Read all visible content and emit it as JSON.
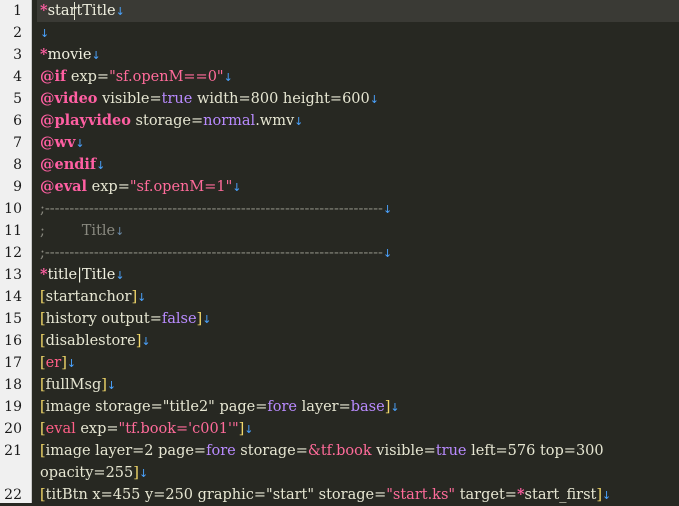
{
  "editor": {
    "eol_glyph": "↓",
    "lines": [
      {
        "n": "1",
        "current": true,
        "tokens": [
          [
            "star",
            "*"
          ],
          [
            "label",
            "startTitle"
          ],
          [
            "eol",
            ""
          ]
        ]
      },
      {
        "n": "2",
        "tokens": [
          [
            "eol",
            ""
          ]
        ]
      },
      {
        "n": "3",
        "tokens": [
          [
            "star",
            "*"
          ],
          [
            "label",
            "movie"
          ],
          [
            "eol",
            ""
          ]
        ]
      },
      {
        "n": "4",
        "tokens": [
          [
            "macro",
            "@if"
          ],
          [
            "plain",
            " "
          ],
          [
            "attr",
            "exp"
          ],
          [
            "plain",
            "="
          ],
          [
            "str",
            "\"sf.openM==0\""
          ],
          [
            "eol",
            ""
          ]
        ]
      },
      {
        "n": "5",
        "tokens": [
          [
            "macro",
            "@video"
          ],
          [
            "plain",
            " "
          ],
          [
            "attr",
            "visible"
          ],
          [
            "plain",
            "="
          ],
          [
            "kw",
            "true"
          ],
          [
            "plain",
            " "
          ],
          [
            "attr",
            "width"
          ],
          [
            "plain",
            "=800 "
          ],
          [
            "attr",
            "height"
          ],
          [
            "plain",
            "=600"
          ],
          [
            "eol",
            ""
          ]
        ]
      },
      {
        "n": "6",
        "tokens": [
          [
            "macro",
            "@playvideo"
          ],
          [
            "plain",
            " "
          ],
          [
            "attr",
            "storage"
          ],
          [
            "plain",
            "="
          ],
          [
            "kw",
            "normal"
          ],
          [
            "plain",
            ".wmv"
          ],
          [
            "eol",
            ""
          ]
        ]
      },
      {
        "n": "7",
        "tokens": [
          [
            "macro",
            "@wv"
          ],
          [
            "eol",
            ""
          ]
        ]
      },
      {
        "n": "8",
        "tokens": [
          [
            "macro",
            "@endif"
          ],
          [
            "eol",
            ""
          ]
        ]
      },
      {
        "n": "9",
        "tokens": [
          [
            "macro",
            "@eval"
          ],
          [
            "plain",
            " "
          ],
          [
            "attr",
            "exp"
          ],
          [
            "plain",
            "="
          ],
          [
            "str",
            "\"sf.openM=1\""
          ],
          [
            "eol",
            ""
          ]
        ]
      },
      {
        "n": "10",
        "tokens": [
          [
            "comment",
            ";---------------------------------------------------------------------"
          ],
          [
            "eol",
            ""
          ]
        ]
      },
      {
        "n": "11",
        "tokens": [
          [
            "comment",
            ";        Title"
          ],
          [
            "eoldim",
            ""
          ]
        ]
      },
      {
        "n": "12",
        "tokens": [
          [
            "comment",
            ";---------------------------------------------------------------------"
          ],
          [
            "eol",
            ""
          ]
        ]
      },
      {
        "n": "13",
        "tokens": [
          [
            "star",
            "*"
          ],
          [
            "label",
            "title|Title"
          ],
          [
            "eol",
            ""
          ]
        ]
      },
      {
        "n": "14",
        "tokens": [
          [
            "brk",
            "["
          ],
          [
            "plain",
            "startanchor"
          ],
          [
            "brk",
            "]"
          ],
          [
            "eol",
            ""
          ]
        ]
      },
      {
        "n": "15",
        "tokens": [
          [
            "brk",
            "["
          ],
          [
            "plain",
            "history output="
          ],
          [
            "kw",
            "false"
          ],
          [
            "brk",
            "]"
          ],
          [
            "eol",
            ""
          ]
        ]
      },
      {
        "n": "16",
        "tokens": [
          [
            "brk",
            "["
          ],
          [
            "plain",
            "disablestore"
          ],
          [
            "brk",
            "]"
          ],
          [
            "eol",
            ""
          ]
        ]
      },
      {
        "n": "17",
        "tokens": [
          [
            "brk",
            "["
          ],
          [
            "strv",
            "er"
          ],
          [
            "brk",
            "]"
          ],
          [
            "eol",
            ""
          ]
        ]
      },
      {
        "n": "18",
        "tokens": [
          [
            "brk",
            "["
          ],
          [
            "plain",
            "fullMsg"
          ],
          [
            "brk",
            "]"
          ],
          [
            "eol",
            ""
          ]
        ]
      },
      {
        "n": "19",
        "tokens": [
          [
            "brk",
            "["
          ],
          [
            "plain",
            "image storage=\"title2\" page="
          ],
          [
            "kw",
            "fore"
          ],
          [
            "plain",
            " layer="
          ],
          [
            "kw",
            "base"
          ],
          [
            "brk",
            "]"
          ],
          [
            "eol",
            ""
          ]
        ]
      },
      {
        "n": "20",
        "tokens": [
          [
            "brk",
            "["
          ],
          [
            "strv",
            "eval"
          ],
          [
            "plain",
            " exp="
          ],
          [
            "str",
            "\"tf.book='c001'\""
          ],
          [
            "brk",
            "]"
          ],
          [
            "eol",
            ""
          ]
        ]
      },
      {
        "n": "21",
        "tokens": [
          [
            "brk",
            "["
          ],
          [
            "plain",
            "image layer=2 page="
          ],
          [
            "kw",
            "fore"
          ],
          [
            "plain",
            " storage="
          ],
          [
            "str",
            "&tf.book"
          ],
          [
            "plain",
            " visible="
          ],
          [
            "kw",
            "true"
          ],
          [
            "plain",
            " left=576 top=300"
          ]
        ]
      },
      {
        "n": "",
        "tokens": [
          [
            "plain",
            "opacity=255"
          ],
          [
            "brk",
            "]"
          ],
          [
            "eol",
            ""
          ]
        ]
      },
      {
        "n": "22",
        "tokens": [
          [
            "brk",
            "["
          ],
          [
            "plain",
            "titBtn x=455 y=250 graphic=\"start\" storage="
          ],
          [
            "str",
            "\"start.ks\""
          ],
          [
            "plain",
            " target="
          ],
          [
            "star",
            "*"
          ],
          [
            "plain",
            "start_first"
          ],
          [
            "brk",
            "]"
          ],
          [
            "eol",
            ""
          ]
        ]
      }
    ]
  },
  "colors": {
    "background": "#272822",
    "gutter": "#f0f0f0",
    "keyword": "#b98bff",
    "macro": "#ff5fa2",
    "string": "#ff6b9a",
    "comment": "#8a8a80",
    "bracket": "#f2d86a",
    "eol_marker": "#4aa3ff"
  }
}
